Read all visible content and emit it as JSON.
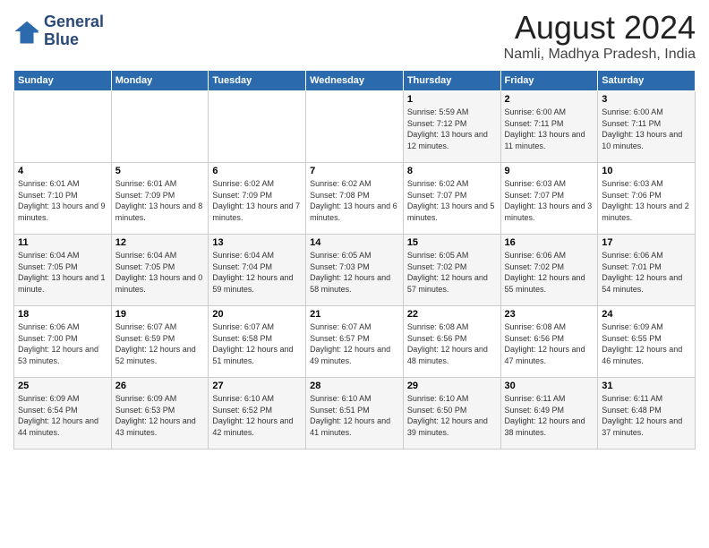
{
  "header": {
    "logo_line1": "General",
    "logo_line2": "Blue",
    "month": "August 2024",
    "location": "Namli, Madhya Pradesh, India"
  },
  "days_of_week": [
    "Sunday",
    "Monday",
    "Tuesday",
    "Wednesday",
    "Thursday",
    "Friday",
    "Saturday"
  ],
  "weeks": [
    [
      {
        "day": "",
        "info": ""
      },
      {
        "day": "",
        "info": ""
      },
      {
        "day": "",
        "info": ""
      },
      {
        "day": "",
        "info": ""
      },
      {
        "day": "1",
        "info": "Sunrise: 5:59 AM\nSunset: 7:12 PM\nDaylight: 13 hours and 12 minutes."
      },
      {
        "day": "2",
        "info": "Sunrise: 6:00 AM\nSunset: 7:11 PM\nDaylight: 13 hours and 11 minutes."
      },
      {
        "day": "3",
        "info": "Sunrise: 6:00 AM\nSunset: 7:11 PM\nDaylight: 13 hours and 10 minutes."
      }
    ],
    [
      {
        "day": "4",
        "info": "Sunrise: 6:01 AM\nSunset: 7:10 PM\nDaylight: 13 hours and 9 minutes."
      },
      {
        "day": "5",
        "info": "Sunrise: 6:01 AM\nSunset: 7:09 PM\nDaylight: 13 hours and 8 minutes."
      },
      {
        "day": "6",
        "info": "Sunrise: 6:02 AM\nSunset: 7:09 PM\nDaylight: 13 hours and 7 minutes."
      },
      {
        "day": "7",
        "info": "Sunrise: 6:02 AM\nSunset: 7:08 PM\nDaylight: 13 hours and 6 minutes."
      },
      {
        "day": "8",
        "info": "Sunrise: 6:02 AM\nSunset: 7:07 PM\nDaylight: 13 hours and 5 minutes."
      },
      {
        "day": "9",
        "info": "Sunrise: 6:03 AM\nSunset: 7:07 PM\nDaylight: 13 hours and 3 minutes."
      },
      {
        "day": "10",
        "info": "Sunrise: 6:03 AM\nSunset: 7:06 PM\nDaylight: 13 hours and 2 minutes."
      }
    ],
    [
      {
        "day": "11",
        "info": "Sunrise: 6:04 AM\nSunset: 7:05 PM\nDaylight: 13 hours and 1 minute."
      },
      {
        "day": "12",
        "info": "Sunrise: 6:04 AM\nSunset: 7:05 PM\nDaylight: 13 hours and 0 minutes."
      },
      {
        "day": "13",
        "info": "Sunrise: 6:04 AM\nSunset: 7:04 PM\nDaylight: 12 hours and 59 minutes."
      },
      {
        "day": "14",
        "info": "Sunrise: 6:05 AM\nSunset: 7:03 PM\nDaylight: 12 hours and 58 minutes."
      },
      {
        "day": "15",
        "info": "Sunrise: 6:05 AM\nSunset: 7:02 PM\nDaylight: 12 hours and 57 minutes."
      },
      {
        "day": "16",
        "info": "Sunrise: 6:06 AM\nSunset: 7:02 PM\nDaylight: 12 hours and 55 minutes."
      },
      {
        "day": "17",
        "info": "Sunrise: 6:06 AM\nSunset: 7:01 PM\nDaylight: 12 hours and 54 minutes."
      }
    ],
    [
      {
        "day": "18",
        "info": "Sunrise: 6:06 AM\nSunset: 7:00 PM\nDaylight: 12 hours and 53 minutes."
      },
      {
        "day": "19",
        "info": "Sunrise: 6:07 AM\nSunset: 6:59 PM\nDaylight: 12 hours and 52 minutes."
      },
      {
        "day": "20",
        "info": "Sunrise: 6:07 AM\nSunset: 6:58 PM\nDaylight: 12 hours and 51 minutes."
      },
      {
        "day": "21",
        "info": "Sunrise: 6:07 AM\nSunset: 6:57 PM\nDaylight: 12 hours and 49 minutes."
      },
      {
        "day": "22",
        "info": "Sunrise: 6:08 AM\nSunset: 6:56 PM\nDaylight: 12 hours and 48 minutes."
      },
      {
        "day": "23",
        "info": "Sunrise: 6:08 AM\nSunset: 6:56 PM\nDaylight: 12 hours and 47 minutes."
      },
      {
        "day": "24",
        "info": "Sunrise: 6:09 AM\nSunset: 6:55 PM\nDaylight: 12 hours and 46 minutes."
      }
    ],
    [
      {
        "day": "25",
        "info": "Sunrise: 6:09 AM\nSunset: 6:54 PM\nDaylight: 12 hours and 44 minutes."
      },
      {
        "day": "26",
        "info": "Sunrise: 6:09 AM\nSunset: 6:53 PM\nDaylight: 12 hours and 43 minutes."
      },
      {
        "day": "27",
        "info": "Sunrise: 6:10 AM\nSunset: 6:52 PM\nDaylight: 12 hours and 42 minutes."
      },
      {
        "day": "28",
        "info": "Sunrise: 6:10 AM\nSunset: 6:51 PM\nDaylight: 12 hours and 41 minutes."
      },
      {
        "day": "29",
        "info": "Sunrise: 6:10 AM\nSunset: 6:50 PM\nDaylight: 12 hours and 39 minutes."
      },
      {
        "day": "30",
        "info": "Sunrise: 6:11 AM\nSunset: 6:49 PM\nDaylight: 12 hours and 38 minutes."
      },
      {
        "day": "31",
        "info": "Sunrise: 6:11 AM\nSunset: 6:48 PM\nDaylight: 12 hours and 37 minutes."
      }
    ]
  ]
}
